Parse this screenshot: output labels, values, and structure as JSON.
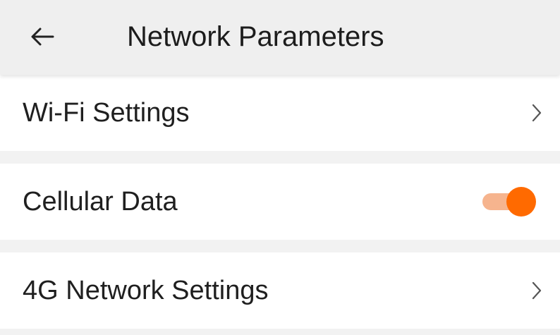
{
  "header": {
    "back_icon": "arrow-left-icon",
    "title": "Network Parameters"
  },
  "items": [
    {
      "label": "Wi-Fi Settings",
      "control": "chevron",
      "icon": "chevron-right-icon"
    },
    {
      "label": "Cellular Data",
      "control": "toggle",
      "toggle_on": true
    },
    {
      "label": "4G Network Settings",
      "control": "chevron",
      "icon": "chevron-right-icon"
    }
  ],
  "colors": {
    "accent": "#ff6a00",
    "toggle_track": "#f6b48e",
    "header_bg": "#efefef",
    "row_bg": "#ffffff",
    "separator_bg": "#f2f2f2"
  }
}
